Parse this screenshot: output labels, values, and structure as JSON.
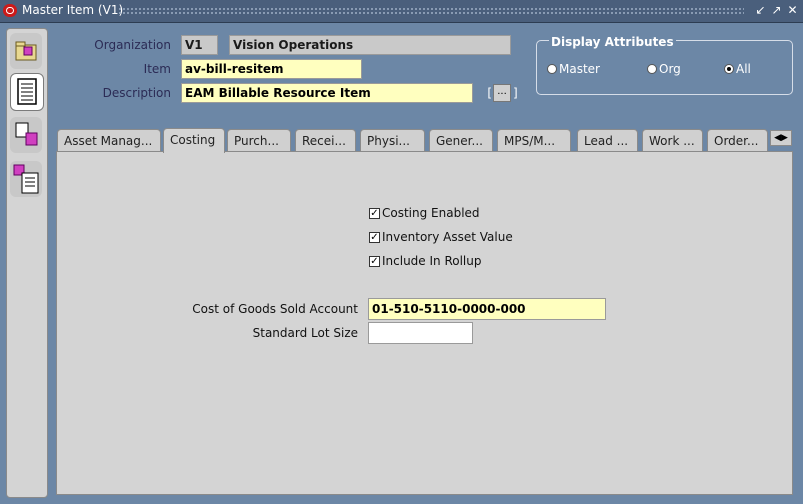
{
  "window": {
    "title": "Master Item (V1)"
  },
  "header": {
    "organization_label": "Organization",
    "organization_code": "V1",
    "organization_name": "Vision Operations",
    "item_label": "Item",
    "item_value": "av-bill-resitem",
    "description_label": "Description",
    "description_value": "EAM Billable Resource Item",
    "flex_bracket_left": "[",
    "flex_button": "...",
    "flex_bracket_right": "]"
  },
  "display_attributes": {
    "title": "Display Attributes",
    "options": [
      {
        "label": "Master",
        "selected": false
      },
      {
        "label": "Org",
        "selected": false
      },
      {
        "label": "All",
        "selected": true
      }
    ]
  },
  "tabs": [
    {
      "label": "Asset Manag..."
    },
    {
      "label": "Costing"
    },
    {
      "label": "Purch..."
    },
    {
      "label": "Recei..."
    },
    {
      "label": "Physi..."
    },
    {
      "label": "Gener..."
    },
    {
      "label": "MPS/M..."
    },
    {
      "label": "Lead ..."
    },
    {
      "label": "Work ..."
    },
    {
      "label": "Order..."
    }
  ],
  "costing": {
    "costing_enabled_label": "Costing Enabled",
    "costing_enabled": true,
    "inventory_asset_label": "Inventory Asset Value",
    "inventory_asset": true,
    "include_rollup_label": "Include In Rollup",
    "include_rollup": true,
    "cogs_label": "Cost of Goods Sold Account",
    "cogs_value": "01-510-5110-0000-000",
    "lot_size_label": "Standard Lot Size",
    "lot_size_value": ""
  }
}
